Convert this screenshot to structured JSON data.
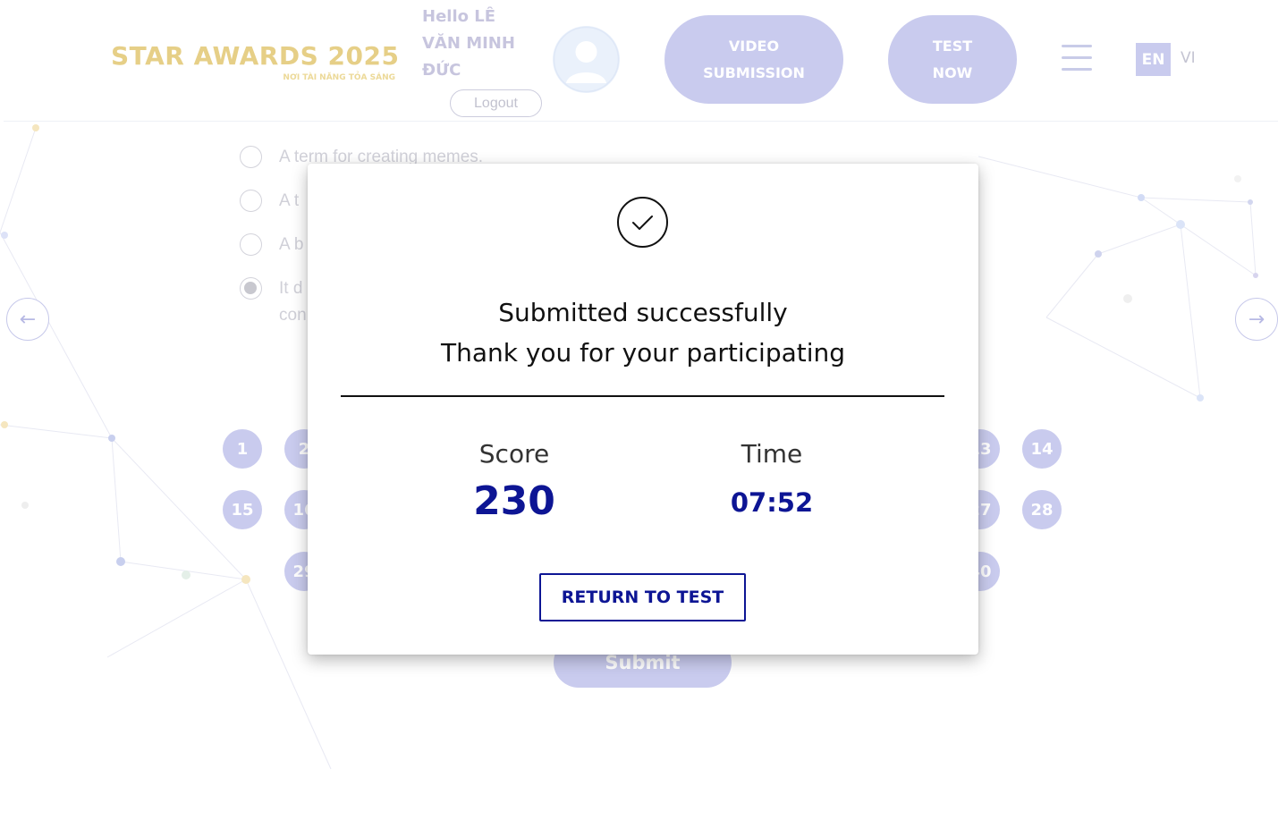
{
  "header": {
    "logo_text": "STAR AWARDS 2025",
    "logo_subtitle": "NƠI TÀI NĂNG TỎA SÁNG",
    "greeting_line1": "Hello LÊ",
    "greeting_line2": "VĂN MINH",
    "greeting_line3": "ĐỨC",
    "logout_label": "Logout",
    "video_submission_line1": "VIDEO",
    "video_submission_line2": "SUBMISSION",
    "test_now_line1": "TEST",
    "test_now_line2": "NOW",
    "lang_en": "EN",
    "lang_vi": "VI"
  },
  "question": {
    "options": [
      {
        "text": "A term for creating memes.",
        "checked": false
      },
      {
        "text": "A t",
        "checked": false
      },
      {
        "text": "A b",
        "checked": false
      },
      {
        "text": "It d",
        "text2": "con",
        "checked": true
      }
    ]
  },
  "navigation": {
    "prev_arrow": "←",
    "next_arrow": "→"
  },
  "question_numbers": {
    "row1": [
      "1",
      "2",
      "13",
      "14"
    ],
    "row2": [
      "15",
      "16",
      "27",
      "28"
    ],
    "row3": [
      "29",
      "40"
    ]
  },
  "submit_label": "Submit",
  "modal": {
    "line1": "Submitted successfully",
    "line2": "Thank you for your participating",
    "score_label": "Score",
    "score_value": "230",
    "time_label": "Time",
    "time_value": "07:52",
    "return_label": "RETURN TO TEST"
  },
  "colors": {
    "accent": "#0d1594",
    "pill": "#c9cbee",
    "logo_gold": "#e6cf87"
  }
}
